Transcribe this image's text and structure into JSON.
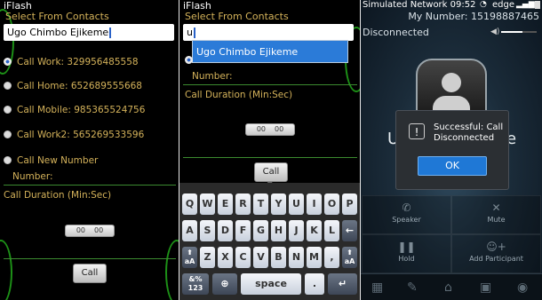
{
  "panel1": {
    "app_title": "iFlash",
    "header": "Select From Contacts",
    "contact_value": "Ugo Chimbo Ejikeme",
    "radios": [
      {
        "label": "Call Work: 329956485558",
        "selected": true
      },
      {
        "label": "Call Home: 652689555668",
        "selected": false
      },
      {
        "label": "Call Mobile: 985365524756",
        "selected": false
      },
      {
        "label": "Call Work2: 565269533596",
        "selected": false
      },
      {
        "label": "Call New Number",
        "selected": false
      }
    ],
    "number_label": "Number:",
    "duration_label": "Call Duration (Min:Sec)",
    "minutes": "00",
    "seconds": "00",
    "call_button": "Call"
  },
  "panel2": {
    "app_title": "iFlash",
    "header": "Select From Contacts",
    "input_value": "u",
    "suggestion": "Ugo Chimbo Ejikeme",
    "number_label": "Number:",
    "duration_label": "Call Duration (Min:Sec)",
    "minutes": "00",
    "seconds": "00",
    "call_button": "Call",
    "keyboard": {
      "row1": [
        "Q",
        "W",
        "E",
        "R",
        "T",
        "Y",
        "U",
        "I",
        "O",
        "P"
      ],
      "row2": [
        "A",
        "S",
        "D",
        "F",
        "G",
        "H",
        "J",
        "K",
        "L"
      ],
      "row3": [
        "Z",
        "X",
        "C",
        "V",
        "B",
        "N",
        "M",
        ","
      ],
      "shift_label": "aA",
      "sym_label": "&%\n123",
      "space_label": "space",
      "period_label": "."
    }
  },
  "panel3": {
    "status_text": "Simulated Network 09:52",
    "carrier": "edge",
    "my_number": "My Number: 15198887465",
    "status": "Disconnected",
    "caller_partial_left": "U",
    "caller_partial_right": "e",
    "dialog_line1": "Successful: Call",
    "dialog_line2": "Disconnected",
    "ok_label": "OK",
    "actions": [
      "Speaker",
      "Mute",
      "Hold",
      "Add Participant"
    ]
  }
}
